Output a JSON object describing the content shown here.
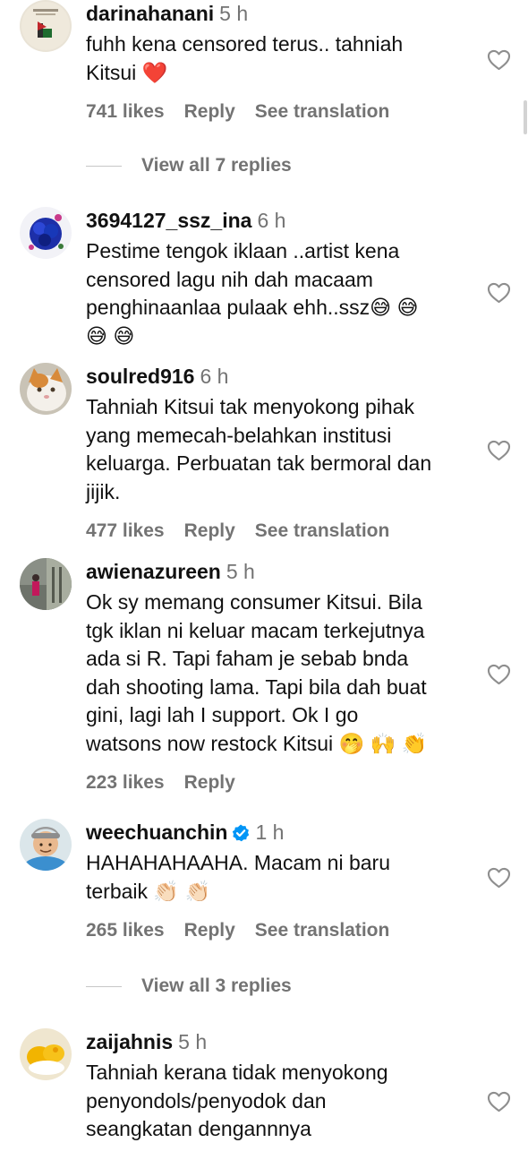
{
  "comments": [
    {
      "username": "darinahanani",
      "time": "5 h",
      "text": "fuhh kena censored terus.. tahniah\nKitsui ❤️",
      "actions": {
        "likes": "741 likes",
        "reply": "Reply",
        "translate": "See translation"
      },
      "view_replies": "View all 7 replies"
    },
    {
      "username": "3694127_ssz_ina",
      "time": "6 h",
      "text": "Pestime tengok iklaan ..artist kena\ncensored lagu nih dah macaam\npenghinaanlaa pulaak ehh..ssz😅 😅\n😅 😅"
    },
    {
      "username": "soulred916",
      "time": "6 h",
      "text": "Tahniah Kitsui tak menyokong pihak\nyang memecah-belahkan institusi\nkeluarga. Perbuatan tak bermoral dan\njijik.",
      "actions": {
        "likes": "477 likes",
        "reply": "Reply",
        "translate": "See translation"
      }
    },
    {
      "username": "awienazureen",
      "time": "5 h",
      "text": "Ok sy memang consumer Kitsui. Bila\ntgk iklan ni keluar macam terkejutnya\nada si R. Tapi faham je sebab bnda\ndah shooting lama. Tapi bila dah buat\ngini, lagi lah I support. Ok I go\nwatsons now restock Kitsui 🤭 🙌 👏",
      "actions": {
        "likes": "223 likes",
        "reply": "Reply"
      }
    },
    {
      "username": "weechuanchin",
      "time": "1 h",
      "verified": true,
      "text": "HAHAHAHAAHA. Macam ni baru\nterbaik 👏🏻 👏🏻",
      "actions": {
        "likes": "265 likes",
        "reply": "Reply",
        "translate": "See translation"
      },
      "view_replies": "View all 3 replies"
    },
    {
      "username": "zaijahnis",
      "time": "5 h",
      "text": "Tahniah kerana tidak menyokong\npenyondols/penyodok dan\nseangkatan dengannnya"
    }
  ],
  "icons": {
    "like": "heart-outline-icon",
    "verified": "verified-badge-icon"
  },
  "colors": {
    "secondary_text": "#737373",
    "verified_blue": "#0095f6"
  }
}
